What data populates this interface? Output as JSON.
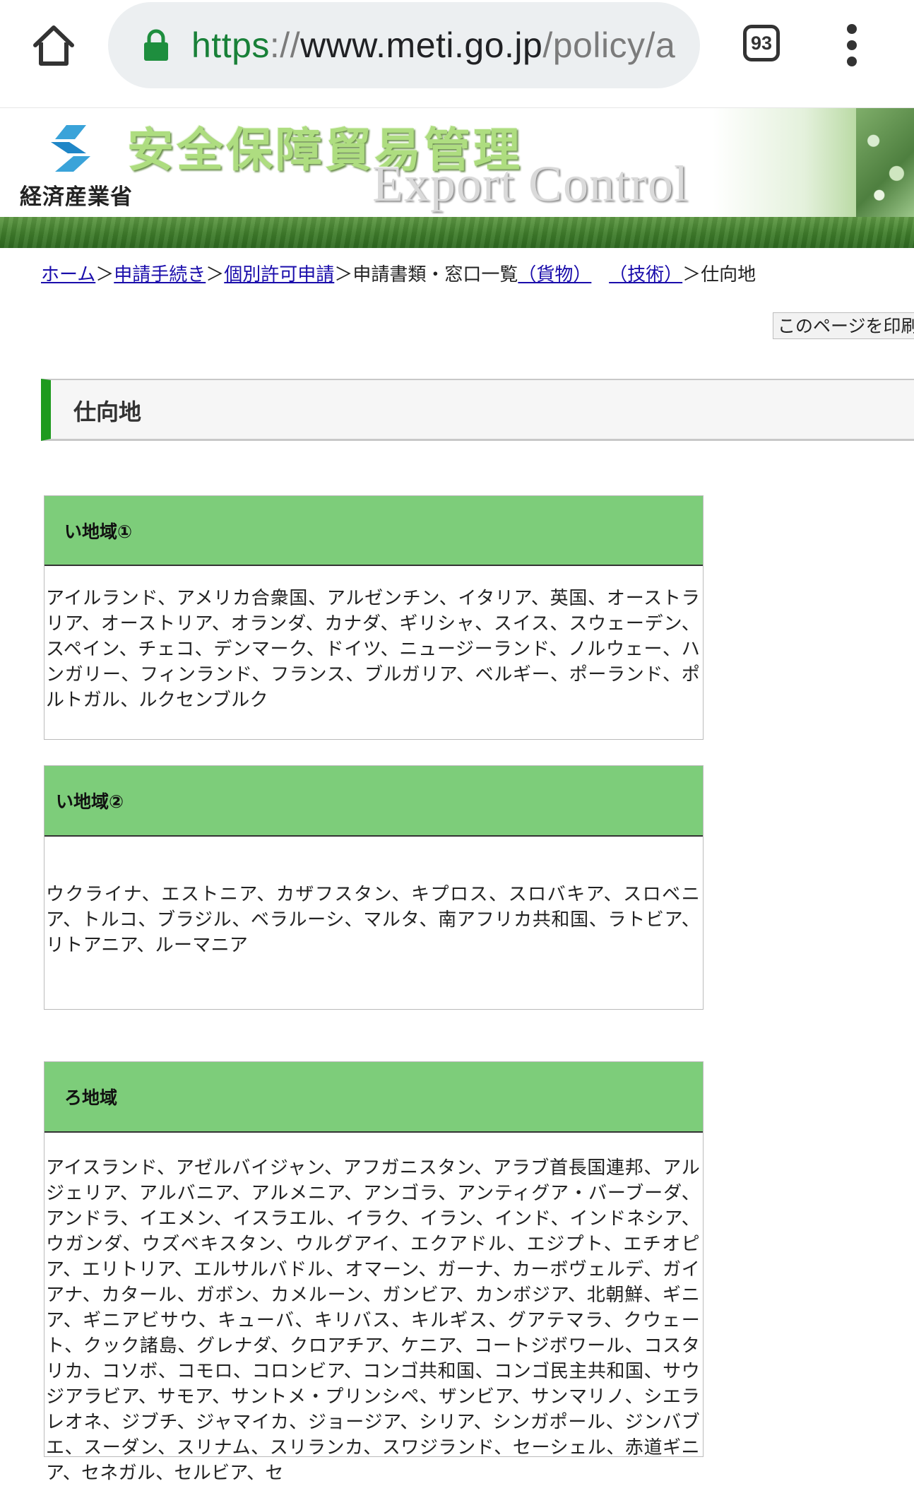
{
  "browser": {
    "url_scheme": "https",
    "url_sep": "://",
    "url_host": "www.meti.go.jp",
    "url_path": "/policy/a",
    "tab_count": "93"
  },
  "site": {
    "ministry_name": "経済産業省",
    "title_jp": "安全保障貿易管理",
    "title_en": "Export Control"
  },
  "breadcrumb": {
    "home": "ホーム",
    "procedures": "申請手続き",
    "individual_permit": "個別許可申請",
    "list_text": "申請書類・窓口一覧",
    "goods": "（貨物）",
    "technology": "（技術）",
    "current": "仕向地",
    "separator": "＞"
  },
  "print_button": "このページを印刷",
  "page_title": "仕向地",
  "regions": [
    {
      "title": "い地域①",
      "countries": "アイルランド、アメリカ合衆国、アルゼンチン、イタリア、英国、オーストラリア、オーストリア、オランダ、カナダ、ギリシャ、スイス、スウェーデン、スペイン、チェコ、デンマーク、ドイツ、ニュージーランド、ノルウェー、ハンガリー、フィンランド、フランス、ブルガリア、ベルギー、ポーランド、ポルトガル、ルクセンブルク"
    },
    {
      "title": "い地域②",
      "countries": "ウクライナ、エストニア、カザフスタン、キプロス、スロバキア、スロベニア、トルコ、ブラジル、ベラルーシ、マルタ、南アフリカ共和国、ラトビア、リトアニア、ルーマニア"
    },
    {
      "title": "ろ地域",
      "countries": "アイスランド、アゼルバイジャン、アフガニスタン、アラブ首長国連邦、アルジェリア、アルバニア、アルメニア、アンゴラ、アンティグア・バーブーダ、アンドラ、イエメン、イスラエル、イラク、イラン、インド、インドネシア、ウガンダ、ウズベキスタン、ウルグアイ、エクアドル、エジプト、エチオピア、エリトリア、エルサルバドル、オマーン、ガーナ、カーボヴェルデ、ガイアナ、カタール、ガボン、カメルーン、ガンビア、カンボジア、北朝鮮、ギニア、ギニアビサウ、キューバ、キリバス、キルギス、グアテマラ、クウェート、クック諸島、グレナダ、クロアチア、ケニア、コートジボワール、コスタリカ、コソボ、コモロ、コロンビア、コンゴ共和国、コンゴ民主共和国、サウジアラビア、サモア、サントメ・プリンシペ、ザンビア、サンマリノ、シエラレオネ、ジブチ、ジャマイカ、ジョージア、シリア、シンガポール、ジンバブエ、スーダン、スリナム、スリランカ、スワジランド、セーシェル、赤道ギニア、セネガル、セルビア、セ"
    }
  ]
}
